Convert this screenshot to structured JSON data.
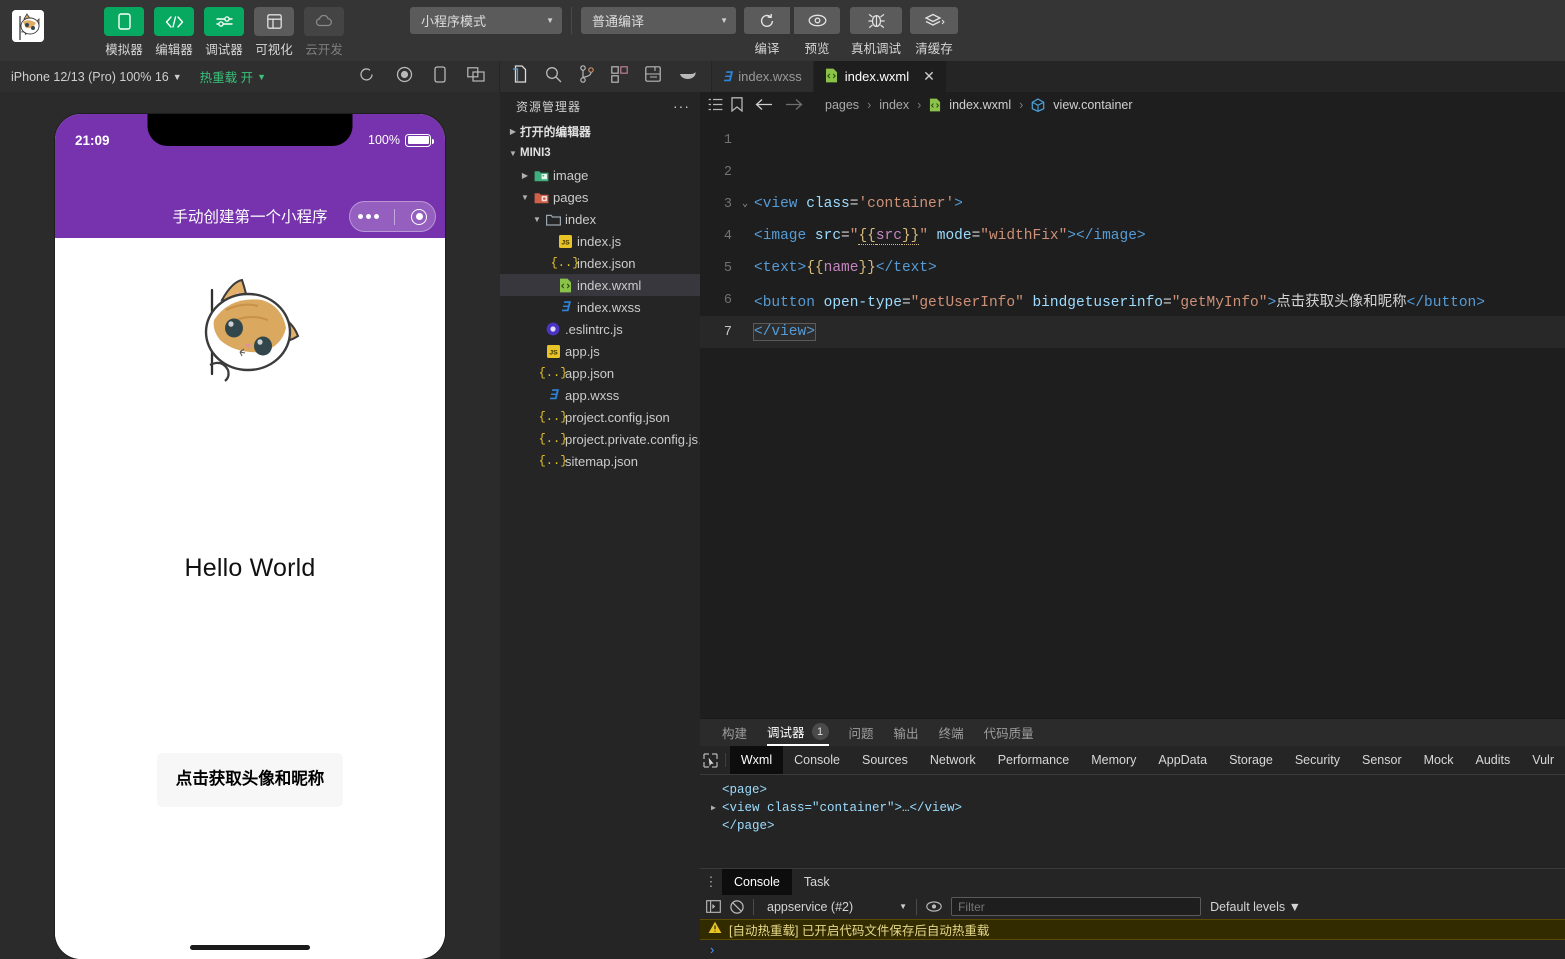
{
  "toolbar": {
    "logo_icon": "cat-avatar-logo",
    "buttons": [
      {
        "label": "模拟器",
        "icon": "phone-icon",
        "state": "active"
      },
      {
        "label": "编辑器",
        "icon": "code-icon",
        "state": "active"
      },
      {
        "label": "调试器",
        "icon": "sliders-icon",
        "state": "active"
      },
      {
        "label": "可视化",
        "icon": "layout-icon",
        "state": "inactive"
      },
      {
        "label": "云开发",
        "icon": "cloud-icon",
        "state": "disabled"
      }
    ],
    "mode_select": "小程序模式",
    "compile_select": "普通编译",
    "actions": [
      {
        "label": "编译",
        "icon": "refresh-icon"
      },
      {
        "label": "预览",
        "icon": "eye-icon"
      },
      {
        "label": "真机调试",
        "icon": "bug-icon"
      },
      {
        "label": "清缓存",
        "icon": "layers-icon"
      }
    ]
  },
  "subbar": {
    "device": "iPhone 12/13 (Pro) 100% 16",
    "hotreload": "热重载 开",
    "sim_icons": [
      "refresh-icon",
      "record-icon",
      "device-icon",
      "windows-icon"
    ],
    "activity_icons": [
      "explorer-icon",
      "search-icon",
      "source-control-icon",
      "extensions-icon",
      "save-icon",
      "docker-icon"
    ],
    "tabs": [
      {
        "label": "index.wxss",
        "icon": "wxss-file-icon",
        "active": false,
        "closable": false
      },
      {
        "label": "index.wxml",
        "icon": "wxml-file-icon",
        "active": true,
        "closable": true,
        "close": "✕"
      }
    ]
  },
  "simulator": {
    "status": {
      "time": "21:09",
      "battery_pct": "100%"
    },
    "nav_title": "手动创建第一个小程序",
    "capsule": {
      "more_icon": "more-dots-icon",
      "target_icon": "target-icon"
    },
    "page": {
      "image_alt": "cat-illustration",
      "text": "Hello World",
      "button_label": "点击获取头像和昵称"
    }
  },
  "explorer": {
    "title": "资源管理器",
    "more": "···",
    "open_editors": "打开的编辑器",
    "project": "MINI3",
    "items": [
      {
        "label": "image",
        "icon": "folder-image-icon",
        "indent": 1,
        "arrow": "▶",
        "selected": false
      },
      {
        "label": "pages",
        "icon": "folder-pages-icon",
        "indent": 1,
        "arrow": "▼",
        "selected": false
      },
      {
        "label": "index",
        "icon": "folder-icon",
        "indent": 2,
        "arrow": "▼",
        "selected": false
      },
      {
        "label": "index.js",
        "icon": "js-file-icon",
        "indent": 3,
        "arrow": "",
        "selected": false
      },
      {
        "label": "index.json",
        "icon": "json-file-icon",
        "indent": 3,
        "arrow": "",
        "selected": false
      },
      {
        "label": "index.wxml",
        "icon": "wxml-file-icon",
        "indent": 3,
        "arrow": "",
        "selected": true
      },
      {
        "label": "index.wxss",
        "icon": "wxss-file-icon",
        "indent": 3,
        "arrow": "",
        "selected": false
      },
      {
        "label": ".eslintrc.js",
        "icon": "eslint-file-icon",
        "indent": 2,
        "arrow": "",
        "selected": false
      },
      {
        "label": "app.js",
        "icon": "js-file-icon",
        "indent": 2,
        "arrow": "",
        "selected": false
      },
      {
        "label": "app.json",
        "icon": "json-file-icon",
        "indent": 2,
        "arrow": "",
        "selected": false
      },
      {
        "label": "app.wxss",
        "icon": "wxss-file-icon",
        "indent": 2,
        "arrow": "",
        "selected": false
      },
      {
        "label": "project.config.json",
        "icon": "json-file-icon",
        "indent": 2,
        "arrow": "",
        "selected": false
      },
      {
        "label": "project.private.config.js…",
        "icon": "json-file-icon",
        "indent": 2,
        "arrow": "",
        "selected": false
      },
      {
        "label": "sitemap.json",
        "icon": "json-file-icon",
        "indent": 2,
        "arrow": "",
        "selected": false
      }
    ]
  },
  "breadcrumb": {
    "icons": [
      "outline-icon",
      "bookmark-icon",
      "back-arrow-icon",
      "forward-arrow-icon"
    ],
    "crumbs": [
      "pages",
      "index",
      "index.wxml",
      "view.container"
    ],
    "sep": "›"
  },
  "code": {
    "language": "wxml",
    "lines": [
      {
        "n": "1",
        "fold": "",
        "current": false
      },
      {
        "n": "2",
        "fold": "",
        "current": false
      },
      {
        "n": "3",
        "fold": "⌄",
        "current": false
      },
      {
        "n": "4",
        "fold": "",
        "current": false
      },
      {
        "n": "5",
        "fold": "",
        "current": false
      },
      {
        "n": "6",
        "fold": "",
        "current": false
      },
      {
        "n": "7",
        "fold": "",
        "current": true
      }
    ],
    "line3": "<view class='container'>",
    "line4": "<image src=\"{{src}}\" mode=\"widthFix\"></image>",
    "line5": "<text>{{name}}</text>",
    "line6": "<button open-type=\"getUserInfo\" bindgetuserinfo=\"getMyInfo\">点击获取头像和昵称</button>",
    "line7": "</view>"
  },
  "debugger": {
    "panel_tabs": [
      {
        "label": "构建",
        "badge": "",
        "active": false
      },
      {
        "label": "调试器",
        "badge": "1",
        "active": true
      },
      {
        "label": "问题",
        "badge": "",
        "active": false
      },
      {
        "label": "输出",
        "badge": "",
        "active": false
      },
      {
        "label": "终端",
        "badge": "",
        "active": false
      },
      {
        "label": "代码质量",
        "badge": "",
        "active": false
      }
    ],
    "inspect_icon": "inspect-element-icon",
    "devtools_tabs": [
      {
        "label": "Wxml",
        "active": true
      },
      {
        "label": "Console",
        "active": false
      },
      {
        "label": "Sources",
        "active": false
      },
      {
        "label": "Network",
        "active": false
      },
      {
        "label": "Performance",
        "active": false
      },
      {
        "label": "Memory",
        "active": false
      },
      {
        "label": "AppData",
        "active": false
      },
      {
        "label": "Storage",
        "active": false
      },
      {
        "label": "Security",
        "active": false
      },
      {
        "label": "Sensor",
        "active": false
      },
      {
        "label": "Mock",
        "active": false
      },
      {
        "label": "Audits",
        "active": false
      },
      {
        "label": "Vulr",
        "active": false
      }
    ],
    "wxml_tree": {
      "open_tag": "<page>",
      "child": "<view class=\"container\">…</view>",
      "close_tag": "</page>",
      "tri": "▶"
    }
  },
  "console": {
    "tabs": [
      {
        "label": "Console",
        "active": true
      },
      {
        "label": "Task",
        "active": false
      }
    ],
    "kebab": "⋮",
    "icons": [
      "sidebar-toggle-icon",
      "clear-console-icon",
      "eye-icon"
    ],
    "context": "appservice (#2)",
    "context_caret": "▼",
    "filter_placeholder": "Filter",
    "filter_value": "",
    "levels": "Default levels ▼",
    "messages": [
      {
        "level": "warning",
        "icon": "warning-icon",
        "text": "[自动热重载] 已开启代码文件保存后自动热重载"
      }
    ],
    "prompt": "›"
  },
  "colors": {
    "accent_green": "#07a85f",
    "nav_purple": "#7732ae",
    "editor_bg": "#1e1e1e",
    "panel_bg": "#252526",
    "toolbar_bg": "#353535",
    "warning_bg": "#332b00"
  }
}
